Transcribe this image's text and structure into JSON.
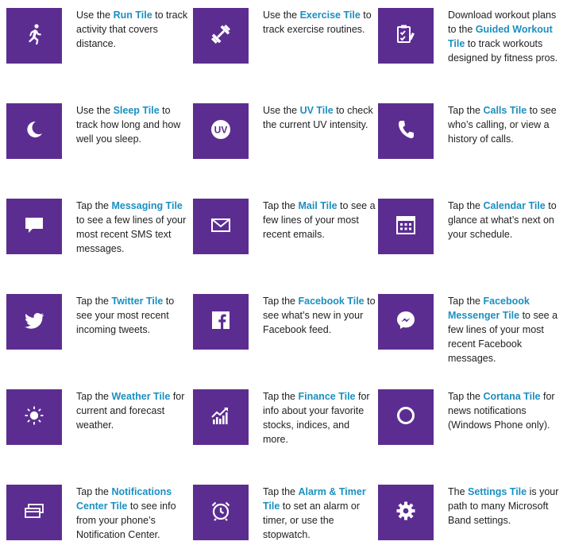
{
  "colors": {
    "tile": "#5c2d91",
    "highlight": "#1b8fc0",
    "text": "#222222"
  },
  "tiles": [
    {
      "icon": "run-icon",
      "parts": [
        "Use the ",
        "Run Tile",
        " to track activity that covers distance."
      ]
    },
    {
      "icon": "exercise-icon",
      "parts": [
        "Use the ",
        "Exercise Tile",
        " to track exercise routines."
      ]
    },
    {
      "icon": "guided-workout-icon",
      "parts": [
        "Download workout plans to the ",
        "Guided Workout Tile",
        " to track workouts designed by fitness pros."
      ]
    },
    {
      "icon": "sleep-icon",
      "parts": [
        "Use the ",
        "Sleep Tile",
        " to track how long and how well you sleep."
      ]
    },
    {
      "icon": "uv-icon",
      "parts": [
        "Use the ",
        "UV Tile",
        " to check the current UV intensity."
      ]
    },
    {
      "icon": "phone-icon",
      "parts": [
        "Tap the ",
        "Calls Tile",
        " to see who’s calling, or view a history of calls."
      ]
    },
    {
      "icon": "message-icon",
      "parts": [
        "Tap the ",
        "Messaging Tile",
        " to see a few lines of your most recent SMS text messages."
      ]
    },
    {
      "icon": "mail-icon",
      "parts": [
        "Tap the ",
        "Mail Tile",
        " to see a few lines of your most recent emails."
      ]
    },
    {
      "icon": "calendar-icon",
      "parts": [
        "Tap the ",
        "Calendar Tile",
        " to glance at what’s next on your schedule."
      ]
    },
    {
      "icon": "twitter-icon",
      "parts": [
        "Tap the ",
        "Twitter Tile",
        " to see your most recent incoming tweets."
      ]
    },
    {
      "icon": "facebook-icon",
      "parts": [
        "Tap the ",
        "Facebook Tile",
        " to see what’s new in your Facebook feed."
      ]
    },
    {
      "icon": "messenger-icon",
      "parts": [
        "Tap the ",
        "Facebook Messenger Tile",
        " to see a few lines of your most recent Facebook messages."
      ]
    },
    {
      "icon": "weather-icon",
      "parts": [
        "Tap the ",
        "Weather Tile",
        " for current and forecast weather."
      ]
    },
    {
      "icon": "finance-icon",
      "parts": [
        "Tap the ",
        "Finance Tile",
        " for info about your favorite stocks, indices, and more."
      ]
    },
    {
      "icon": "cortana-icon",
      "parts": [
        "Tap the ",
        "Cortana Tile",
        " for news notifications (Windows Phone only)."
      ]
    },
    {
      "icon": "notifications-icon",
      "parts": [
        "Tap the ",
        "Notifications Center Tile",
        " to see info from your phone’s Notification Center."
      ]
    },
    {
      "icon": "alarm-icon",
      "parts": [
        "Tap the ",
        "Alarm & Timer Tile",
        " to set an alarm or timer, or use the stopwatch."
      ]
    },
    {
      "icon": "settings-icon",
      "parts": [
        "The ",
        "Settings Tile",
        " is your path to many Microsoft Band settings."
      ]
    }
  ]
}
